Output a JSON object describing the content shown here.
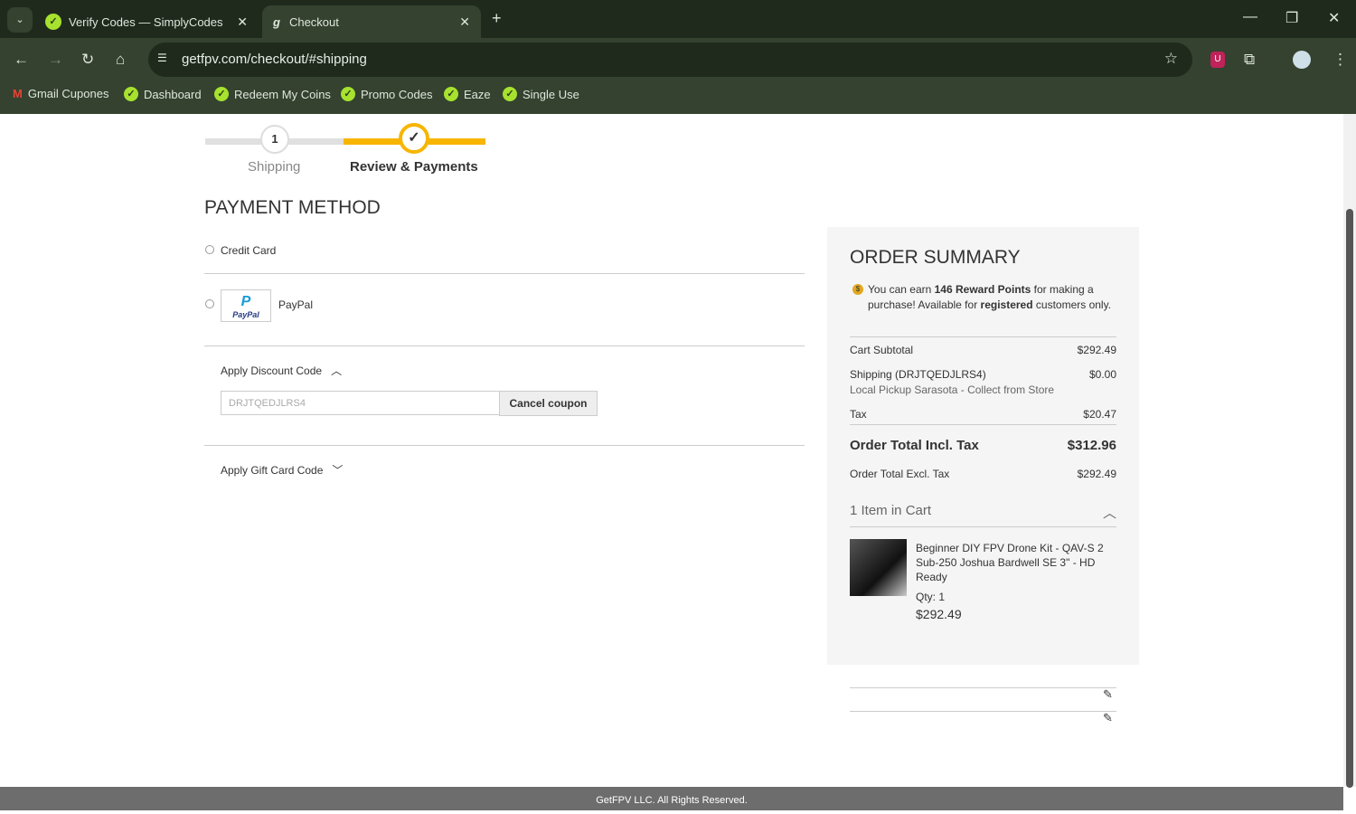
{
  "browser": {
    "tabs": [
      {
        "title": "Verify Codes — SimplyCodes"
      },
      {
        "title": "Checkout"
      }
    ],
    "url": "getfpv.com/checkout/#shipping",
    "bookmarks": [
      "Gmail Cupones",
      "Dashboard",
      "Redeem My Coins",
      "Promo Codes",
      "Eaze",
      "Single Use"
    ]
  },
  "steps": [
    {
      "num": "1",
      "label": "Shipping"
    },
    {
      "label": "Review & Payments"
    }
  ],
  "payment": {
    "title": "PAYMENT METHOD",
    "credit_card": "Credit Card",
    "paypal": "PayPal",
    "paypal_logo": "PayPal",
    "discount_label": "Apply Discount Code",
    "discount_value": "DRJTQEDJLRS4",
    "cancel_coupon": "Cancel coupon",
    "gift_label": "Apply Gift Card Code"
  },
  "summary": {
    "title": "ORDER SUMMARY",
    "reward_pre": "You can earn ",
    "reward_bold": "146 Reward Points",
    "reward_mid": " for making a purchase! Available for ",
    "reward_bold2": "registered",
    "reward_post": " customers only.",
    "subtotal_label": "Cart Subtotal",
    "subtotal": "$292.49",
    "shipping_label": "Shipping (DRJTQEDJLRS4)",
    "shipping": "$0.00",
    "shipping_method": "Local Pickup Sarasota - Collect from Store",
    "tax_label": "Tax",
    "tax": "$20.47",
    "total_incl_label": "Order Total Incl. Tax",
    "total_incl": "$312.96",
    "total_excl_label": "Order Total Excl. Tax",
    "total_excl": "$292.49",
    "items_label": "1 Item in Cart",
    "item": {
      "name": "Beginner DIY FPV Drone Kit - QAV-S 2 Sub-250 Joshua Bardwell SE 3\" - HD Ready",
      "qty": "Qty: 1",
      "price": "$292.49"
    }
  },
  "footer": "GetFPV LLC. All Rights Reserved."
}
